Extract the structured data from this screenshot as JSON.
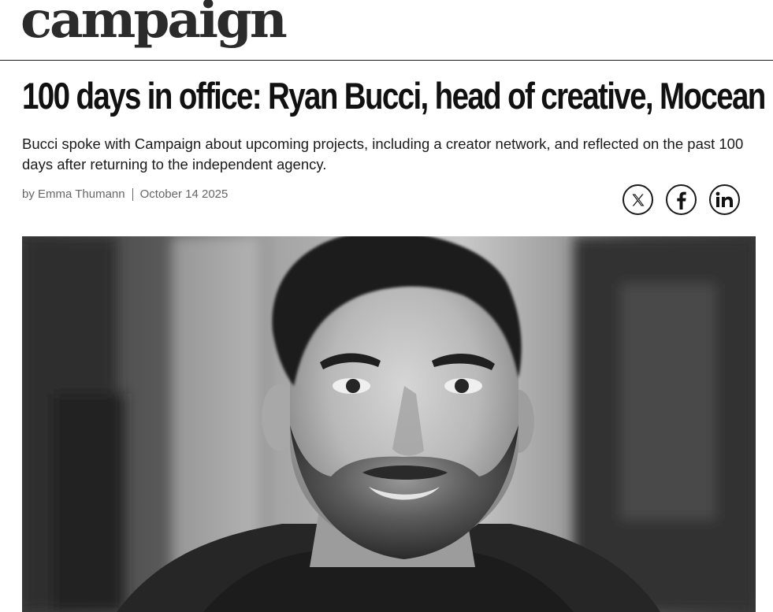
{
  "masthead": {
    "logo_text": "campaign"
  },
  "article": {
    "headline": "100 days in office: Ryan Bucci, head of creative, Mocean",
    "standfirst": "Bucci spoke with Campaign about upcoming projects, including a creator network, and reflected on the past 100 days after returning to the independent agency.",
    "byline": {
      "prefix": "by",
      "author": "Emma Thumann",
      "date": "October 14 2025"
    }
  },
  "share": {
    "buttons": [
      {
        "icon": "x-icon",
        "network": "X"
      },
      {
        "icon": "facebook-icon",
        "network": "Facebook"
      },
      {
        "icon": "linkedin-icon",
        "network": "LinkedIn"
      }
    ]
  },
  "hero_image": {
    "subject": "portrait-photo",
    "colors": {
      "style": "black-and-white"
    }
  }
}
